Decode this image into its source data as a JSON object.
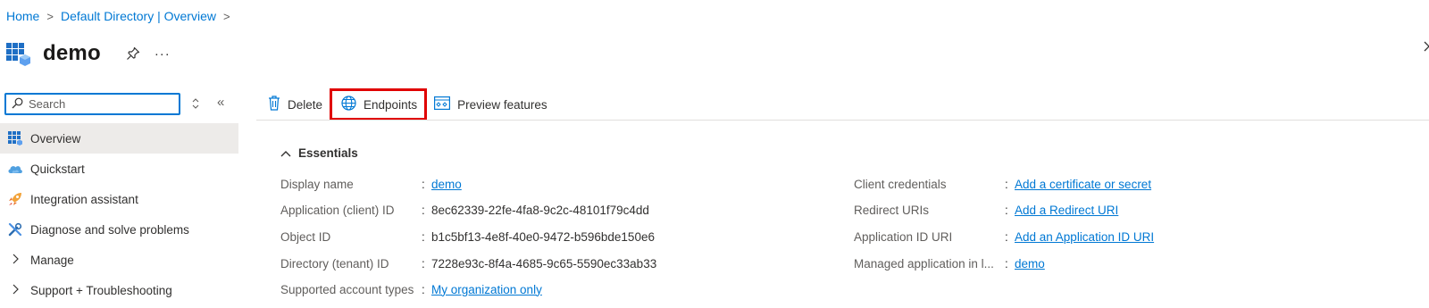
{
  "breadcrumb": {
    "items": [
      "Home",
      "Default Directory | Overview"
    ],
    "separator": ">"
  },
  "header": {
    "title": "demo",
    "more_label": "···"
  },
  "sidebar": {
    "search_placeholder": "Search",
    "collapse_label": "«",
    "items": [
      {
        "label": "Overview",
        "icon": "app-registration-icon",
        "active": true
      },
      {
        "label": "Quickstart",
        "icon": "cloud-icon"
      },
      {
        "label": "Integration assistant",
        "icon": "rocket-icon"
      },
      {
        "label": "Diagnose and solve problems",
        "icon": "wrench-icon"
      },
      {
        "label": "Manage",
        "icon": "chevron-right-icon"
      },
      {
        "label": "Support + Troubleshooting",
        "icon": "chevron-right-icon"
      }
    ]
  },
  "toolbar": {
    "delete_label": "Delete",
    "endpoints_label": "Endpoints",
    "preview_label": "Preview features"
  },
  "essentials": {
    "heading": "Essentials",
    "colon": ":",
    "left": [
      {
        "label": "Display name",
        "value": "demo",
        "link": true
      },
      {
        "label": "Application (client) ID",
        "value": "8ec62339-22fe-4fa8-9c2c-48101f79c4dd",
        "link": false
      },
      {
        "label": "Object ID",
        "value": "b1c5bf13-4e8f-40e0-9472-b596bde150e6",
        "link": false
      },
      {
        "label": "Directory (tenant) ID",
        "value": "7228e93c-8f4a-4685-9c65-5590ec33ab33",
        "link": false
      },
      {
        "label": "Supported account types",
        "value": "My organization only",
        "link": true
      }
    ],
    "right": [
      {
        "label": "Client credentials",
        "value": "Add a certificate or secret",
        "link": true
      },
      {
        "label": "Redirect URIs",
        "value": "Add a Redirect URI",
        "link": true
      },
      {
        "label": "Application ID URI",
        "value": "Add an Application ID URI",
        "link": true
      },
      {
        "label": "Managed application in l...",
        "value": "demo",
        "link": true
      }
    ]
  },
  "colors": {
    "link": "#0078d4",
    "highlight_border": "#e00000",
    "active_nav": "#edebe9"
  }
}
